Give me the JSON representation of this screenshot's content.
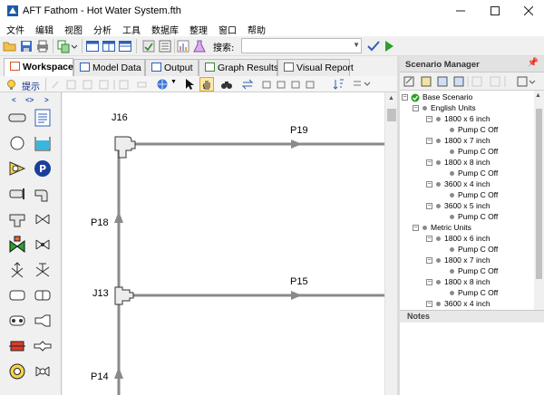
{
  "window": {
    "title": "AFT Fathom - Hot Water System.fth"
  },
  "menu": [
    "文件",
    "编辑",
    "视图",
    "分析",
    "工具",
    "数据库",
    "整理",
    "窗口",
    "帮助"
  ],
  "toolbar": {
    "search_label": "搜索:",
    "search_value": ""
  },
  "tabs": [
    {
      "label": "Workspace",
      "active": true
    },
    {
      "label": "Model Data",
      "active": false
    },
    {
      "label": "Output",
      "active": false
    },
    {
      "label": "Graph Results",
      "active": false
    },
    {
      "label": "Visual Report",
      "active": false
    }
  ],
  "workspace_toolbar": {
    "tip_label": "提示"
  },
  "palette_nav": [
    "<",
    "<>",
    ">"
  ],
  "canvas": {
    "junctions": [
      "J16",
      "J13"
    ],
    "pipes": [
      "P19",
      "P18",
      "P15",
      "P14"
    ]
  },
  "scenario_manager": {
    "title": "Scenario Manager",
    "tree": [
      {
        "label": "Base Scenario",
        "level": 0
      },
      {
        "label": "English Units",
        "level": 1
      },
      {
        "label": "1800 x 6 inch",
        "level": 2
      },
      {
        "label": "Pump C Off",
        "level": 3
      },
      {
        "label": "1800 x 7 inch",
        "level": 2
      },
      {
        "label": "Pump C Off",
        "level": 3
      },
      {
        "label": "1800 x 8 inch",
        "level": 2
      },
      {
        "label": "Pump C Off",
        "level": 3
      },
      {
        "label": "3600 x 4 inch",
        "level": 2
      },
      {
        "label": "Pump C Off",
        "level": 3
      },
      {
        "label": "3600 x 5 inch",
        "level": 2
      },
      {
        "label": "Pump C Off",
        "level": 3
      },
      {
        "label": "Metric Units",
        "level": 1
      },
      {
        "label": "1800 x 6 inch",
        "level": 2
      },
      {
        "label": "Pump C Off",
        "level": 3
      },
      {
        "label": "1800 x 7 inch",
        "level": 2
      },
      {
        "label": "Pump C Off",
        "level": 3
      },
      {
        "label": "1800 x 8 inch",
        "level": 2
      },
      {
        "label": "Pump C Off",
        "level": 3
      },
      {
        "label": "3600 x 4 inch",
        "level": 2
      }
    ],
    "notes_title": "Notes"
  }
}
